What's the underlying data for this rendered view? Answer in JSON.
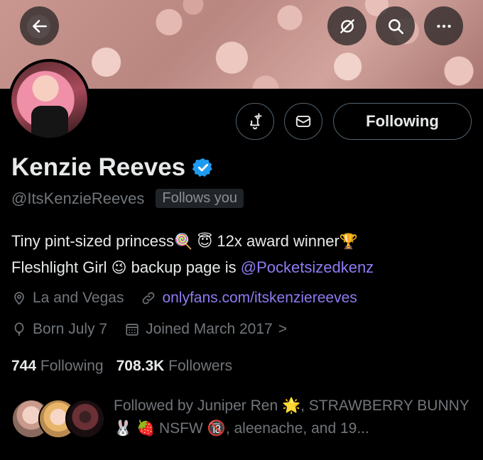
{
  "header": {
    "back_icon": "arrow-left-icon",
    "grok_icon": "slash-circle-icon",
    "search_icon": "search-icon",
    "more_icon": "more-horizontal-icon"
  },
  "profile": {
    "name": "Kenzie Reeves",
    "handle": "@ItsKenzieReeves",
    "follows_you": "Follows you",
    "verified_color": "#1d9bf0"
  },
  "actions": {
    "notify_icon": "bell-plus-icon",
    "message_icon": "envelope-icon",
    "following_label": "Following"
  },
  "bio": {
    "line1_text": "Tiny pint-sized princess",
    "line1_emoji1": "🍭",
    "line1_emoji2": "😇",
    "line1_text2": "12x award winner",
    "line1_emoji3": "🏆",
    "line2_text": "Fleshlight Girl",
    "line2_emoji": "😉",
    "line2_text2": "backup page is",
    "mention": "@Pocketsizedkenz"
  },
  "meta": {
    "location": "La and Vegas",
    "website": "onlyfans.com/itskenziereeves",
    "birthday": "Born July 7",
    "joined": "Joined March 2017",
    "joined_chevron": ">"
  },
  "stats": {
    "following_count": "744",
    "following_label": "Following",
    "followers_count": "708.3K",
    "followers_label": "Followers"
  },
  "followed_by": {
    "prefix": "Followed by Juniper Ren",
    "emoji1": "🌟",
    "part2": ", STRAWBERRY BUNNY",
    "emoji2": "🐰",
    "emoji3": "🍓",
    "part3": "NSFW",
    "emoji4": "🔞",
    "suffix": ", aleenache, and 19..."
  },
  "colors": {
    "accent_link": "#8e7cf2",
    "muted": "#71767b",
    "text": "#e7e9ea"
  }
}
